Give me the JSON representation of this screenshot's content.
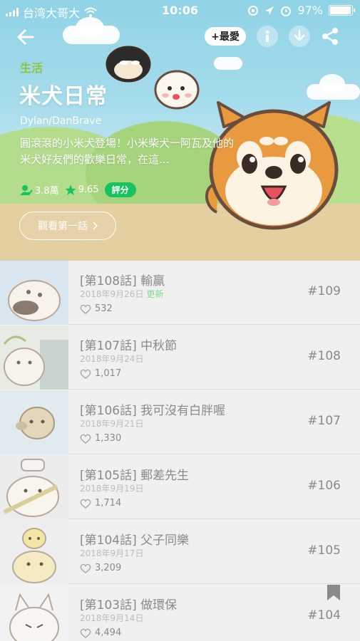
{
  "status_bar": {
    "carrier": "台湾大哥大",
    "time": "10:06",
    "battery": "97%",
    "battery_level": 0.97
  },
  "header": {
    "favorite_label": "+最愛",
    "genre": "生活",
    "title": "米犬日常",
    "author": "Dylan/DanBrave",
    "description": "圓滾滾的小米犬登場！小米柴犬一阿瓦及他的米犬好友們的歡樂日常，在這...",
    "subscribers": "3.8萬",
    "rating": "9.65",
    "rate_label": "評分",
    "watch_button": "觀看第一話"
  },
  "icons": {
    "back": "arrow-left-icon",
    "info": "info-icon",
    "download": "download-icon",
    "share": "share-icon",
    "heart": "heart-icon",
    "star": "star-icon",
    "subscriber": "subscriber-icon",
    "bookmark": "bookmark-icon"
  },
  "colors": {
    "accent_green": "#16c35d",
    "genre_green": "#8cc63e"
  },
  "episodes": [
    {
      "title": "[第108話] 輸贏",
      "date": "2018年9月26日",
      "badge": "更新",
      "likes": "532",
      "number": "#109"
    },
    {
      "title": "[第107話] 中秋節",
      "date": "2018年9月24日",
      "badge": "",
      "likes": "1,017",
      "number": "#108"
    },
    {
      "title": "[第106話] 我可沒有白胖喔",
      "date": "2018年9月21日",
      "badge": "",
      "likes": "1,330",
      "number": "#107"
    },
    {
      "title": "[第105話] 郵差先生",
      "date": "2018年9月19日",
      "badge": "",
      "likes": "1,714",
      "number": "#106"
    },
    {
      "title": "[第104話] 父子同樂",
      "date": "2018年9月17日",
      "badge": "",
      "likes": "3,209",
      "number": "#105"
    },
    {
      "title": "[第103話] 做環保",
      "date": "2018年9月14日",
      "badge": "",
      "likes": "4,494",
      "number": "#104"
    }
  ]
}
